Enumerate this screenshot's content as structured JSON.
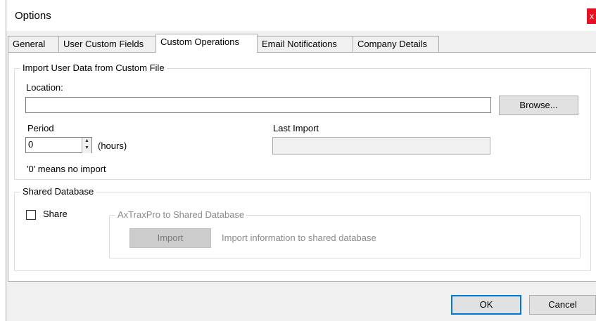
{
  "window": {
    "title": "Options",
    "close_label": "x"
  },
  "tabs": [
    {
      "label": "General"
    },
    {
      "label": "User Custom Fields"
    },
    {
      "label": "Custom Operations",
      "active": true
    },
    {
      "label": "Email Notifications"
    },
    {
      "label": "Company Details"
    }
  ],
  "import_group": {
    "title": "Import User Data from Custom File",
    "location_label": "Location:",
    "location_value": "",
    "browse_label": "Browse...",
    "period_label": "Period",
    "period_value": "0",
    "hours_label": "(hours)",
    "last_import_label": "Last Import",
    "last_import_value": "",
    "note": "'0' means no import"
  },
  "shared_group": {
    "title": "Shared Database",
    "share_label": "Share",
    "share_checked": false,
    "inner_title": "AxTraxPro to Shared Database",
    "import_button_label": "Import",
    "import_description": "Import information to shared database"
  },
  "footer": {
    "ok_label": "OK",
    "cancel_label": "Cancel"
  },
  "colors": {
    "accent": "#0078d7",
    "close": "#e81123"
  }
}
